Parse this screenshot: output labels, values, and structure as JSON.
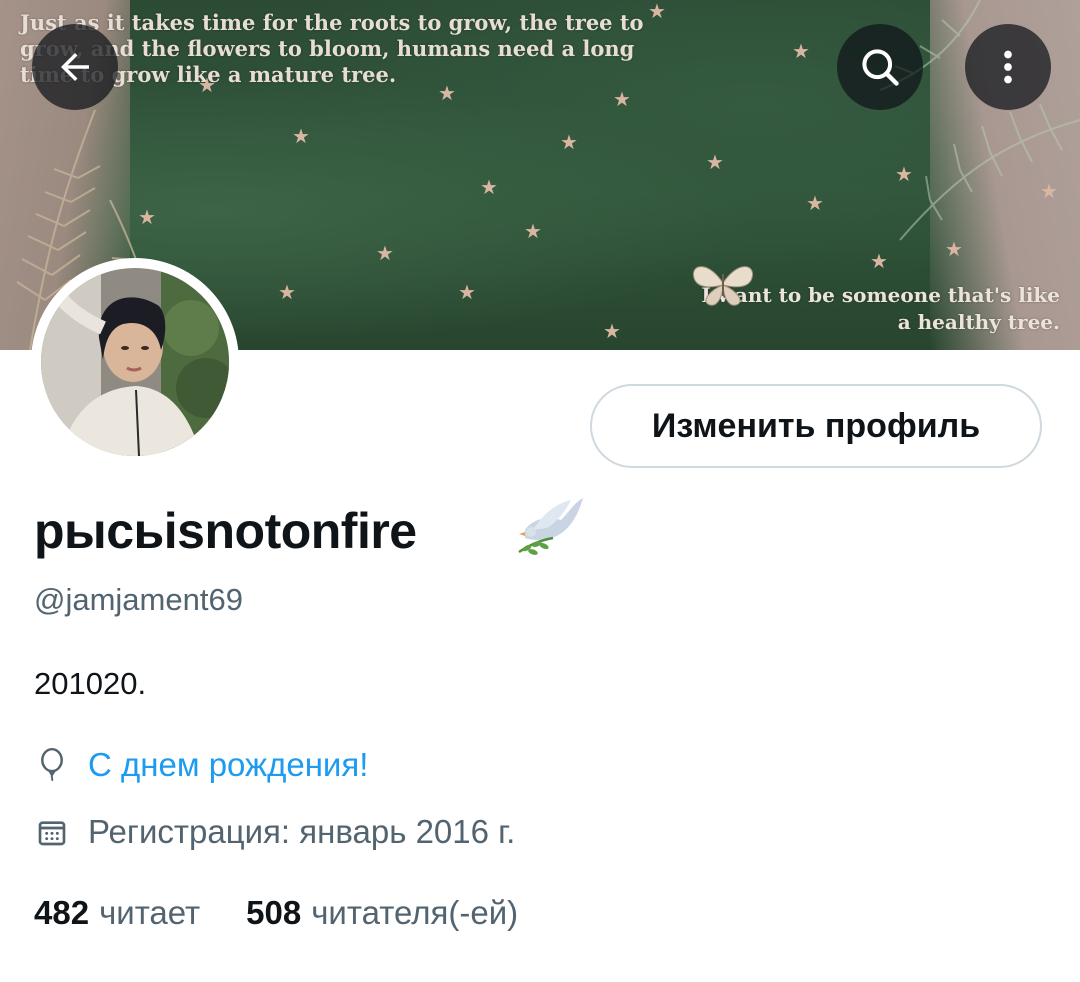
{
  "header": {
    "banner_quote_top": "Just as it takes time for the roots to grow, the tree to grow, and the flowers to bloom, humans need a long time to grow like a mature tree.",
    "banner_quote_bottom": "I want to be someone that's like a healthy tree.",
    "back_icon": "arrow-left-icon",
    "search_icon": "search-icon",
    "more_icon": "more-vertical-icon"
  },
  "profile": {
    "edit_button_label": "Изменить профиль",
    "display_name": "рысьisnotonfire",
    "handle": "@jamjament69",
    "bio": "201020.",
    "birthday": "С днем рождения!",
    "joined": "Регистрация: январь 2016 г.",
    "following_count": "482",
    "following_label": "читает",
    "followers_count": "508",
    "followers_label": "читателя(-ей)"
  },
  "colors": {
    "accent": "#1d9bf0",
    "secondary_text": "#536471",
    "primary_text": "#0f1419",
    "banner_green": "#2e5038"
  }
}
